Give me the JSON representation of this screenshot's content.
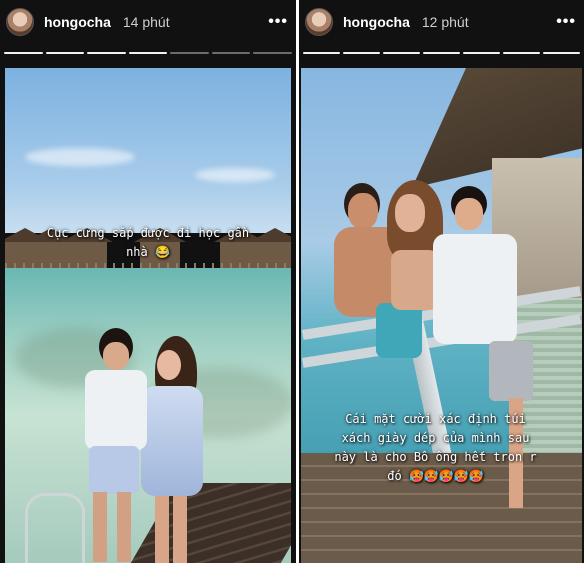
{
  "stories": [
    {
      "username": "hongocha",
      "time": "14 phút",
      "menu_glyph": "•••",
      "progress": {
        "total": 7,
        "active_index": 3
      },
      "caption": "Cục cưng sắp được đi học gần\nnhà 😂"
    },
    {
      "username": "hongocha",
      "time": "12 phút",
      "menu_glyph": "•••",
      "progress": {
        "total": 7,
        "active_index": 6
      },
      "caption": "Cái mặt cười xác định túi\nxách giày dép của mình sau\nnày là cho Bô ông hết tron r\nđó 🥵🥵🥵🥵🥵"
    }
  ],
  "colors": {
    "progress_done": "#f2f2f2",
    "progress_pending": "#6c6c6c",
    "story_bg": "#111111"
  }
}
